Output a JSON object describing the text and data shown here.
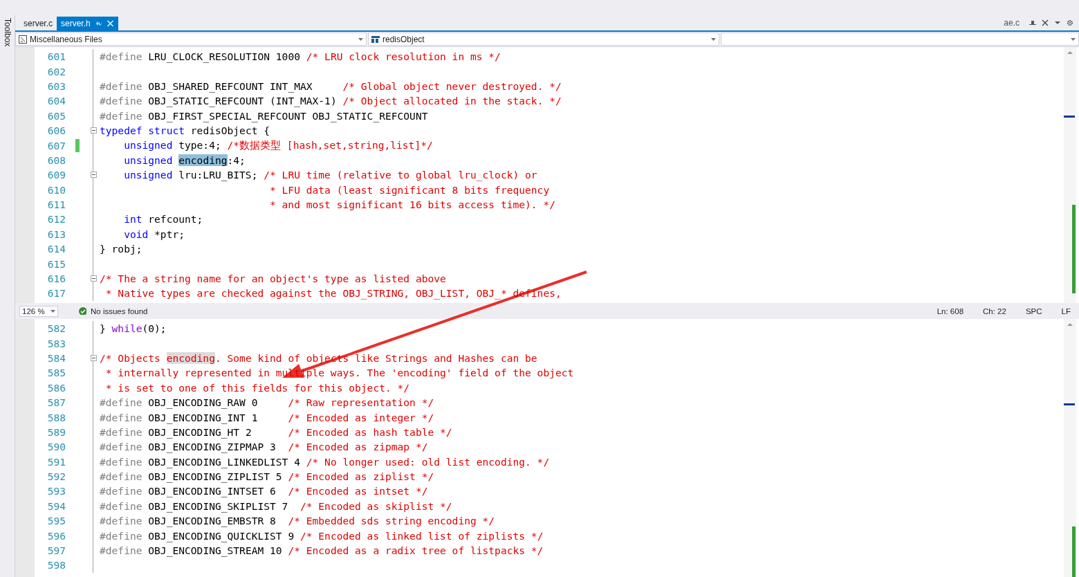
{
  "toolbox": {
    "label": "Toolbox"
  },
  "tabs": [
    {
      "label": "server.c",
      "selected": false
    },
    {
      "label": "server.h",
      "selected": true
    }
  ],
  "preview_tab": {
    "label": "ae.c"
  },
  "navigation": {
    "project": "Miscellaneous Files",
    "scope": "redisObject"
  },
  "top_pane": {
    "lines": [
      {
        "number": "601",
        "fold": false,
        "changed": false,
        "tokens": [
          {
            "kind": "pp",
            "text": "#define"
          },
          {
            "kind": "tx",
            "text": " LRU_CLOCK_RESOLUTION 1000 "
          },
          {
            "kind": "cm",
            "text": "/* LRU clock resolution in ms */"
          }
        ]
      },
      {
        "number": "602",
        "fold": false,
        "changed": false
      },
      {
        "number": "603",
        "fold": false,
        "changed": false,
        "tokens": [
          {
            "kind": "pp",
            "text": "#define"
          },
          {
            "kind": "tx",
            "text": " OBJ_SHARED_REFCOUNT INT_MAX     "
          },
          {
            "kind": "cm",
            "text": "/* Global object never destroyed. */"
          }
        ]
      },
      {
        "number": "604",
        "fold": false,
        "changed": false,
        "tokens": [
          {
            "kind": "pp",
            "text": "#define"
          },
          {
            "kind": "tx",
            "text": " OBJ_STATIC_REFCOUNT (INT_MAX-1) "
          },
          {
            "kind": "cm",
            "text": "/* Object allocated in the stack. */"
          }
        ]
      },
      {
        "number": "605",
        "fold": false,
        "changed": false,
        "tokens": [
          {
            "kind": "pp",
            "text": "#define"
          },
          {
            "kind": "tx",
            "text": " OBJ_FIRST_SPECIAL_REFCOUNT OBJ_STATIC_REFCOUNT"
          }
        ]
      },
      {
        "number": "606",
        "fold": true,
        "changed": false,
        "tokens": [
          {
            "kind": "kw",
            "text": "typedef"
          },
          {
            "kind": "kw",
            "text": " struct"
          },
          {
            "kind": "tx",
            "text": " redisObject {"
          }
        ]
      },
      {
        "number": "607",
        "fold": false,
        "changed": true,
        "tokens": [
          {
            "kind": "kw",
            "text": "    unsigned"
          },
          {
            "kind": "tx",
            "text": " type:4; "
          },
          {
            "kind": "cm",
            "text": "/*数据类型 [hash,set,string,list]*/"
          }
        ]
      },
      {
        "number": "608",
        "fold": false,
        "changed": false,
        "tokens": [
          {
            "kind": "kw",
            "text": "    unsigned "
          },
          {
            "kind": "hl",
            "text": "encoding"
          },
          {
            "kind": "tx",
            "text": ":4;"
          }
        ]
      },
      {
        "number": "609",
        "fold": true,
        "changed": false,
        "tokens": [
          {
            "kind": "kw",
            "text": "    unsigned"
          },
          {
            "kind": "tx",
            "text": " lru:LRU_BITS; "
          },
          {
            "kind": "cm",
            "text": "/* LRU time (relative to global lru_clock) or"
          }
        ]
      },
      {
        "number": "610",
        "fold": false,
        "changed": false,
        "tokens": [
          {
            "kind": "cm",
            "text": "                            * LFU data (least significant 8 bits frequency"
          }
        ]
      },
      {
        "number": "611",
        "fold": false,
        "changed": false,
        "tokens": [
          {
            "kind": "cm",
            "text": "                            * and most significant 16 bits access time). */"
          }
        ]
      },
      {
        "number": "612",
        "fold": false,
        "changed": false,
        "tokens": [
          {
            "kind": "kw",
            "text": "    int"
          },
          {
            "kind": "tx",
            "text": " refcount;"
          }
        ]
      },
      {
        "number": "613",
        "fold": false,
        "changed": false,
        "tokens": [
          {
            "kind": "kw",
            "text": "    void"
          },
          {
            "kind": "tx",
            "text": " *ptr;"
          }
        ]
      },
      {
        "number": "614",
        "fold": false,
        "changed": false,
        "tokens": [
          {
            "kind": "tx",
            "text": "} robj;"
          }
        ]
      },
      {
        "number": "615",
        "fold": false,
        "changed": false
      },
      {
        "number": "616",
        "fold": true,
        "changed": false,
        "tokens": [
          {
            "kind": "cm",
            "text": "/* The a string name for an object's type as listed above"
          }
        ]
      },
      {
        "number": "617",
        "fold": false,
        "changed": false,
        "tokens": [
          {
            "kind": "cm",
            "text": " * Native types are checked against the OBJ_STRING, OBJ_LIST, OBJ_* defines,"
          }
        ]
      }
    ]
  },
  "status_bar": {
    "zoom": "126 %",
    "issues": "No issues found",
    "line": "Ln: 608",
    "column": "Ch: 22",
    "whitespace": "SPC",
    "line_ending": "LF"
  },
  "bottom_pane": {
    "lines": [
      {
        "number": "582",
        "fold": false,
        "changed": false,
        "tokens": [
          {
            "kind": "tx",
            "text": "} "
          },
          {
            "kind": "ctl",
            "text": "while"
          },
          {
            "kind": "tx",
            "text": "(0);"
          }
        ]
      },
      {
        "number": "583",
        "fold": false,
        "changed": false
      },
      {
        "number": "584",
        "fold": true,
        "changed": false,
        "tokens": [
          {
            "kind": "cm",
            "text": "/* Objects "
          },
          {
            "kind": "hlcm",
            "text": "encoding"
          },
          {
            "kind": "cm",
            "text": ". Some kind of objects like Strings and Hashes can be"
          }
        ]
      },
      {
        "number": "585",
        "fold": false,
        "changed": false,
        "tokens": [
          {
            "kind": "cm",
            "text": " * internally represented in multiple ways. The 'encoding' field of the object"
          }
        ]
      },
      {
        "number": "586",
        "fold": false,
        "changed": false,
        "tokens": [
          {
            "kind": "cm",
            "text": " * is set to one of this fields for this object. */"
          }
        ]
      },
      {
        "number": "587",
        "fold": false,
        "changed": false,
        "tokens": [
          {
            "kind": "pp",
            "text": "#define"
          },
          {
            "kind": "tx",
            "text": " OBJ_ENCODING_RAW 0     "
          },
          {
            "kind": "cm",
            "text": "/* Raw representation */"
          }
        ]
      },
      {
        "number": "588",
        "fold": false,
        "changed": false,
        "tokens": [
          {
            "kind": "pp",
            "text": "#define"
          },
          {
            "kind": "tx",
            "text": " OBJ_ENCODING_INT 1     "
          },
          {
            "kind": "cm",
            "text": "/* Encoded as integer */"
          }
        ]
      },
      {
        "number": "589",
        "fold": false,
        "changed": false,
        "tokens": [
          {
            "kind": "pp",
            "text": "#define"
          },
          {
            "kind": "tx",
            "text": " OBJ_ENCODING_HT 2      "
          },
          {
            "kind": "cm",
            "text": "/* Encoded as hash table */"
          }
        ]
      },
      {
        "number": "590",
        "fold": false,
        "changed": false,
        "tokens": [
          {
            "kind": "pp",
            "text": "#define"
          },
          {
            "kind": "tx",
            "text": " OBJ_ENCODING_ZIPMAP 3  "
          },
          {
            "kind": "cm",
            "text": "/* Encoded as zipmap */"
          }
        ]
      },
      {
        "number": "591",
        "fold": false,
        "changed": false,
        "tokens": [
          {
            "kind": "pp",
            "text": "#define"
          },
          {
            "kind": "tx",
            "text": " OBJ_ENCODING_LINKEDLIST 4 "
          },
          {
            "kind": "cm",
            "text": "/* No longer used: old list encoding. */"
          }
        ]
      },
      {
        "number": "592",
        "fold": false,
        "changed": false,
        "tokens": [
          {
            "kind": "pp",
            "text": "#define"
          },
          {
            "kind": "tx",
            "text": " OBJ_ENCODING_ZIPLIST 5 "
          },
          {
            "kind": "cm",
            "text": "/* Encoded as ziplist */"
          }
        ]
      },
      {
        "number": "593",
        "fold": false,
        "changed": false,
        "tokens": [
          {
            "kind": "pp",
            "text": "#define"
          },
          {
            "kind": "tx",
            "text": " OBJ_ENCODING_INTSET 6  "
          },
          {
            "kind": "cm",
            "text": "/* Encoded as intset */"
          }
        ]
      },
      {
        "number": "594",
        "fold": false,
        "changed": false,
        "tokens": [
          {
            "kind": "pp",
            "text": "#define"
          },
          {
            "kind": "tx",
            "text": " OBJ_ENCODING_SKIPLIST 7  "
          },
          {
            "kind": "cm",
            "text": "/* Encoded as skiplist */"
          }
        ]
      },
      {
        "number": "595",
        "fold": false,
        "changed": false,
        "tokens": [
          {
            "kind": "pp",
            "text": "#define"
          },
          {
            "kind": "tx",
            "text": " OBJ_ENCODING_EMBSTR 8  "
          },
          {
            "kind": "cm",
            "text": "/* Embedded sds string encoding */"
          }
        ]
      },
      {
        "number": "596",
        "fold": false,
        "changed": false,
        "tokens": [
          {
            "kind": "pp",
            "text": "#define"
          },
          {
            "kind": "tx",
            "text": " OBJ_ENCODING_QUICKLIST 9 "
          },
          {
            "kind": "cm",
            "text": "/* Encoded as linked list of ziplists */"
          }
        ]
      },
      {
        "number": "597",
        "fold": false,
        "changed": false,
        "tokens": [
          {
            "kind": "pp",
            "text": "#define"
          },
          {
            "kind": "tx",
            "text": " OBJ_ENCODING_STREAM 10 "
          },
          {
            "kind": "cm",
            "text": "/* Encoded as a radix tree of listpacks */"
          }
        ]
      },
      {
        "number": "598",
        "fold": false,
        "changed": false
      }
    ]
  }
}
